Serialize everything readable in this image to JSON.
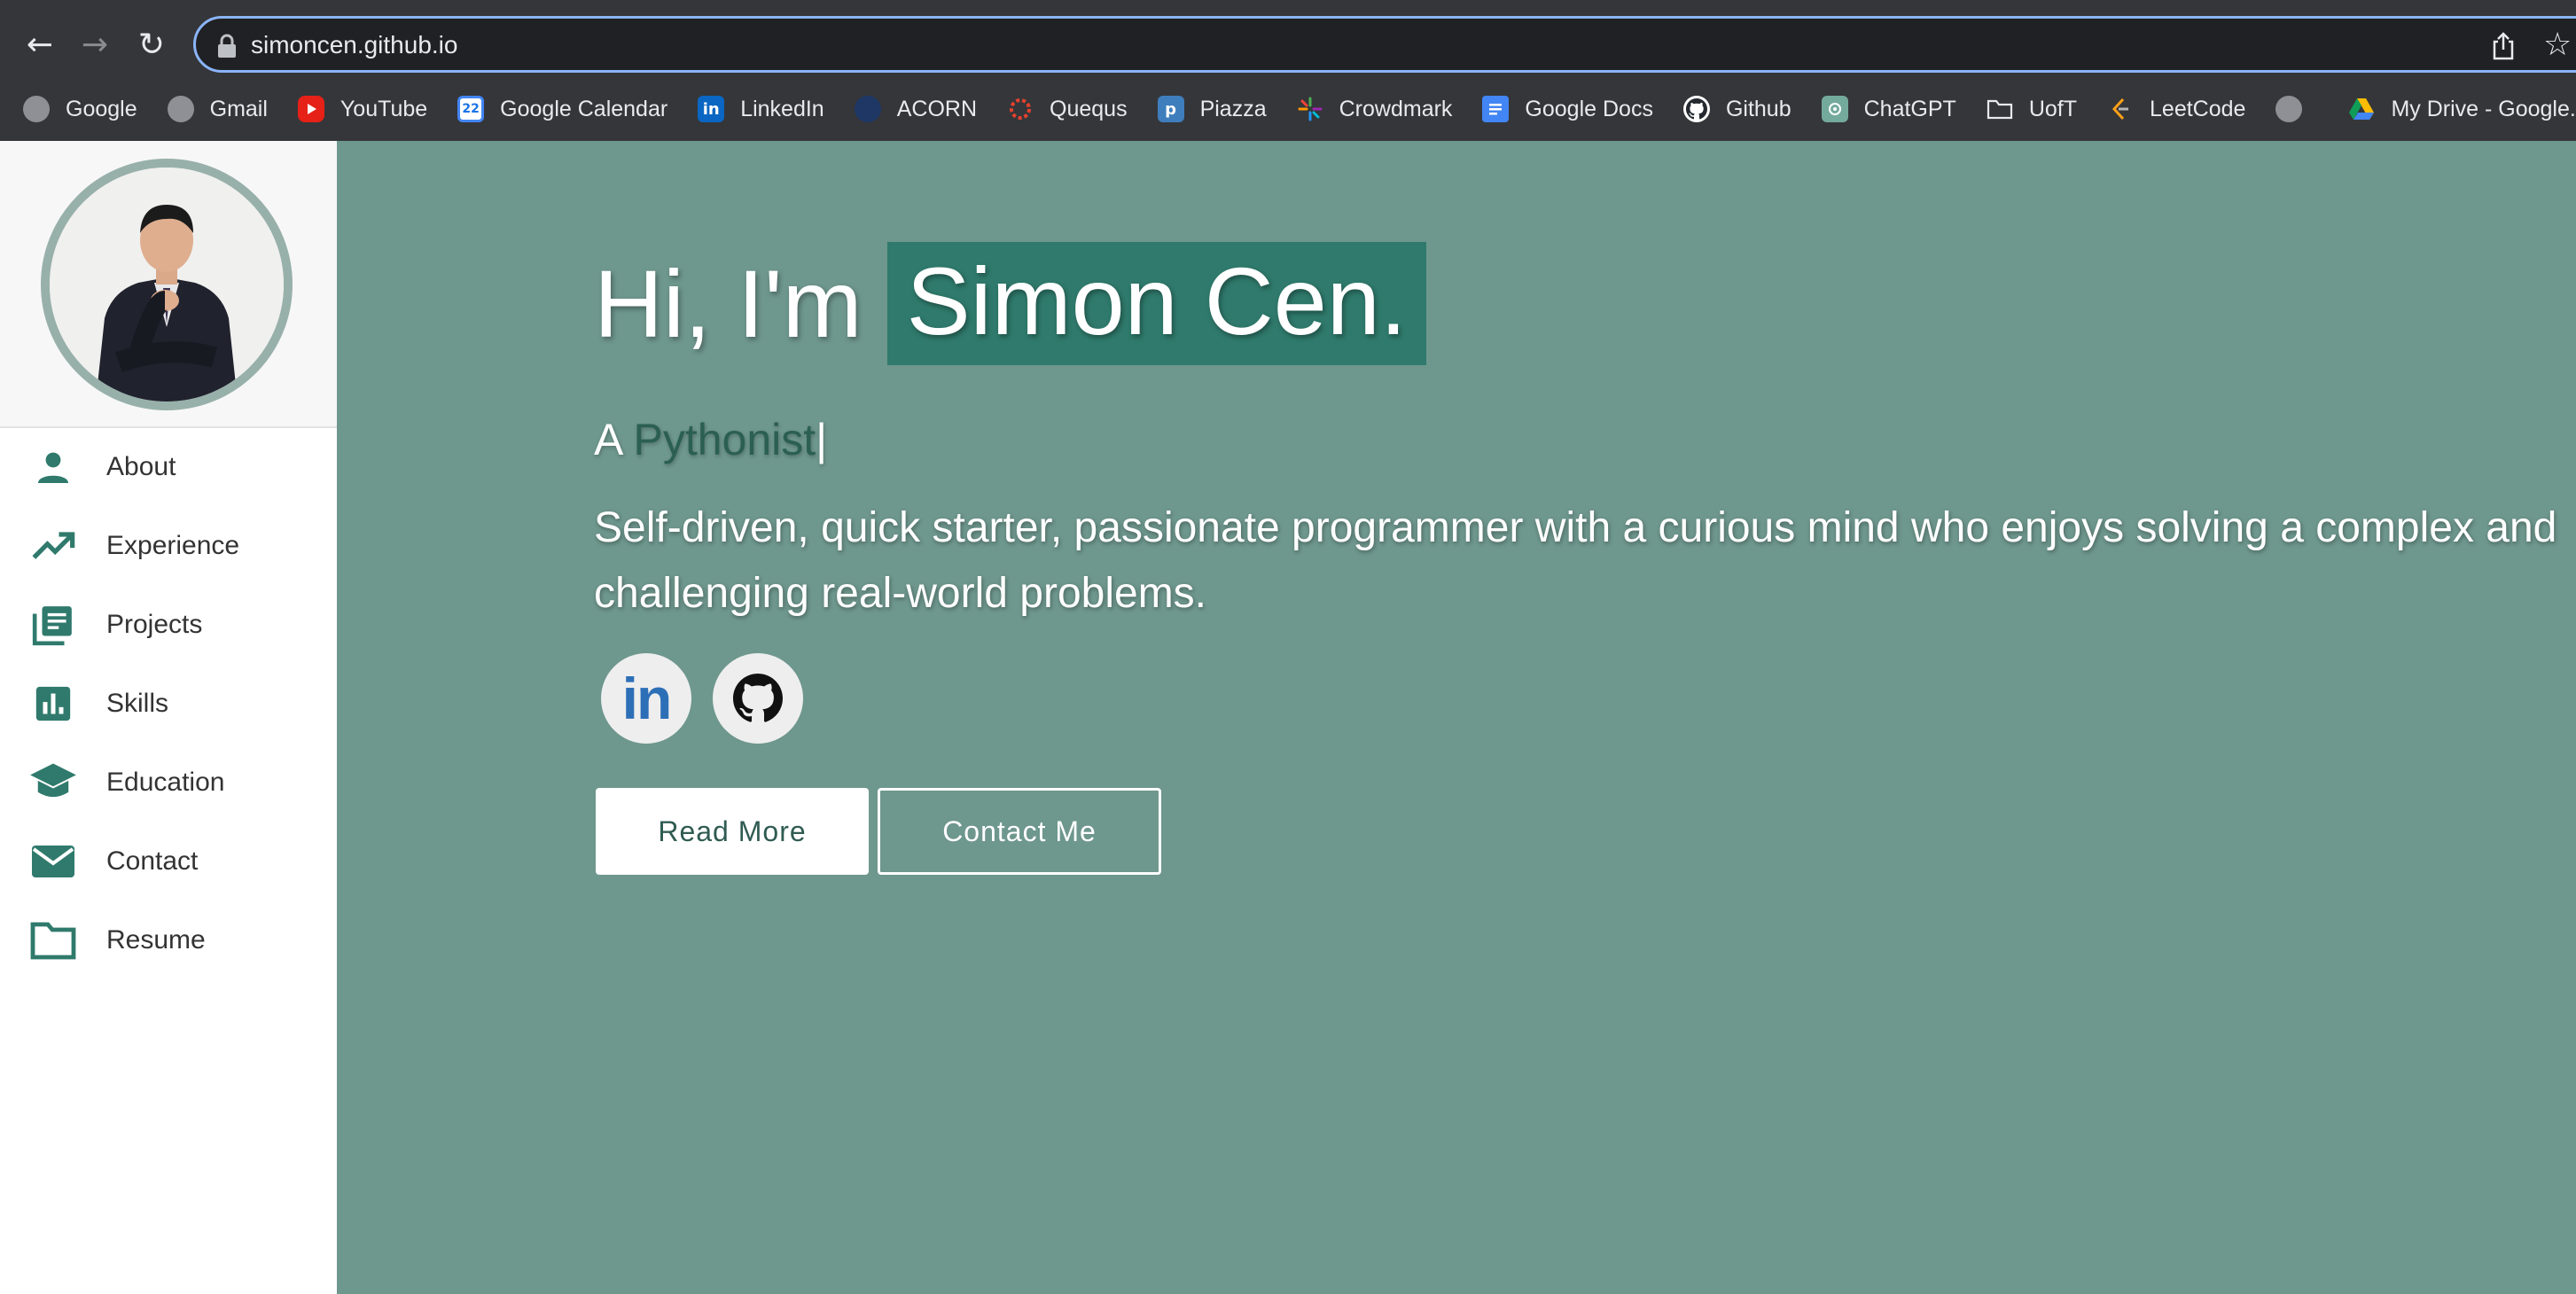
{
  "browser": {
    "url": "simoncen.github.io",
    "bookmarks": [
      {
        "label": "Google",
        "icon": "globe-icon"
      },
      {
        "label": "Gmail",
        "icon": "globe-icon"
      },
      {
        "label": "YouTube",
        "icon": "youtube-icon"
      },
      {
        "label": "Google Calendar",
        "icon": "calendar-icon",
        "icon_text": "22"
      },
      {
        "label": "LinkedIn",
        "icon": "linkedin-icon",
        "icon_text": "in"
      },
      {
        "label": "ACORN",
        "icon": "acorn-icon"
      },
      {
        "label": "Quequs",
        "icon": "quercus-icon"
      },
      {
        "label": "Piazza",
        "icon": "piazza-icon",
        "icon_text": "p"
      },
      {
        "label": "Crowdmark",
        "icon": "crowdmark-icon"
      },
      {
        "label": "Google Docs",
        "icon": "docs-icon"
      },
      {
        "label": "Github",
        "icon": "github-icon"
      },
      {
        "label": "ChatGPT",
        "icon": "chatgpt-icon"
      },
      {
        "label": "UofT",
        "icon": "folder-icon"
      },
      {
        "label": "LeetCode",
        "icon": "leetcode-icon"
      },
      {
        "label": "",
        "icon": "globe-icon"
      },
      {
        "label": "My Drive - Google...",
        "icon": "drive-icon"
      }
    ]
  },
  "sidebar": {
    "items": [
      {
        "label": "About",
        "icon": "person-icon"
      },
      {
        "label": "Experience",
        "icon": "trending-up-icon"
      },
      {
        "label": "Projects",
        "icon": "library-books-icon"
      },
      {
        "label": "Skills",
        "icon": "bar-chart-icon"
      },
      {
        "label": "Education",
        "icon": "graduation-cap-icon"
      },
      {
        "label": "Contact",
        "icon": "mail-icon"
      },
      {
        "label": "Resume",
        "icon": "folder-icon"
      }
    ]
  },
  "hero": {
    "greeting": "Hi, I'm",
    "name": "Simon Cen.",
    "tagline_prefix": "A",
    "tagline_role": "Pythonist",
    "cursor": "|",
    "bio": "Self-driven, quick starter, passionate programmer with a curious mind who enjoys solving a complex and challenging real-world problems.",
    "linkedin_text": "in",
    "read_more_label": "Read More",
    "contact_label": "Contact Me"
  },
  "colors": {
    "accent": "#2f7a6c",
    "hero_bg": "#6e978d",
    "icon_teal": "#2f7a6c"
  }
}
